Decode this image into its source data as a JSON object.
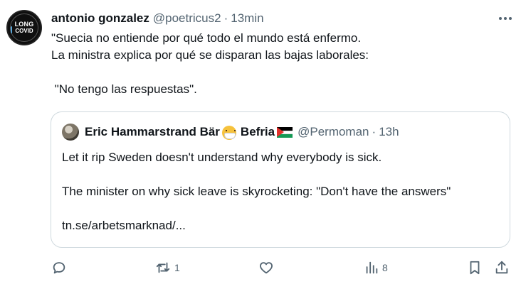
{
  "tweet": {
    "author": {
      "name": "antonio gonzalez",
      "handle": "@poetricus2",
      "separator": "·",
      "time": "13min",
      "avatar_text": [
        "LONG",
        "COVID"
      ]
    },
    "text_lines": [
      "\"Suecia no entiende por qué todo el mundo está enfermo.",
      "La ministra explica por qué se disparan las bajas laborales:",
      "",
      " \"No tengo las respuestas\"."
    ],
    "quote": {
      "name_part1": "Eric Hammarstrand Bär",
      "name_part2": "Befria",
      "handle": "@Permoman",
      "separator": "·",
      "time": "13h",
      "line1": "Let it rip Sweden doesn't understand why everybody is sick.",
      "line2": "The minister on why sick leave is skyrocketing: \"Don't have the answers\"",
      "line3": "tn.se/arbetsmarknad/..."
    },
    "actions": {
      "reply_count": "",
      "retweet_count": "1",
      "like_count": "",
      "views_count": "8"
    }
  },
  "icons": [
    "more-icon",
    "reply-icon",
    "retweet-icon",
    "like-icon",
    "views-icon",
    "bookmark-icon",
    "share-icon",
    "mask-emoji",
    "palestine-flag"
  ],
  "colors": {
    "text": "#0f1419",
    "secondary": "#536471",
    "border": "#cfd9de"
  }
}
